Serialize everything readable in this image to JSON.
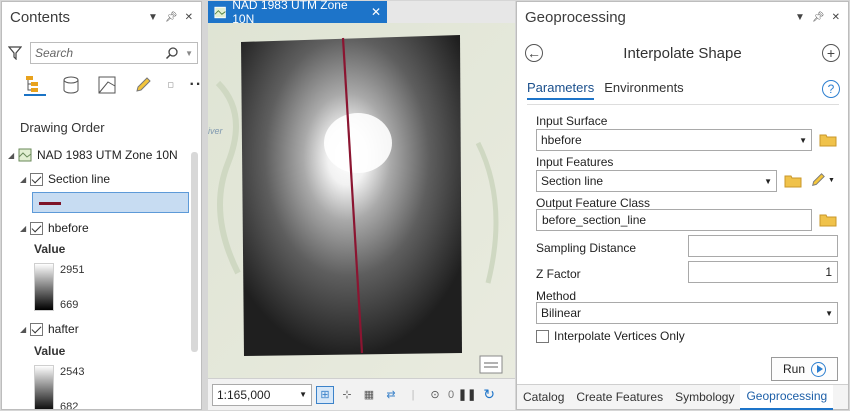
{
  "contents": {
    "title": "Contents",
    "search_placeholder": "Search",
    "drawing_order_label": "Drawing Order",
    "map_name": "NAD 1983 UTM Zone 10N",
    "layers": [
      {
        "name": "Section line",
        "checked": true
      },
      {
        "name": "hbefore",
        "checked": true,
        "value_label": "Value",
        "max": "2951",
        "min": "669"
      },
      {
        "name": "hafter",
        "checked": true,
        "value_label": "Value",
        "max": "2543",
        "min": "682"
      }
    ]
  },
  "map": {
    "tab_title": "NAD 1983 UTM Zone 10N",
    "scale": "1:165,000",
    "selected_count": "0",
    "basemap_label": "iver",
    "section_line_color": "#8b1531"
  },
  "geoprocessing": {
    "title": "Geoprocessing",
    "tool_title": "Interpolate Shape",
    "tabs": {
      "parameters": "Parameters",
      "environments": "Environments"
    },
    "fields": {
      "input_surface": {
        "label": "Input Surface",
        "value": "hbefore"
      },
      "input_features": {
        "label": "Input Features",
        "value": "Section line"
      },
      "output_feature_class": {
        "label": "Output Feature Class",
        "value": "before_section_line"
      },
      "sampling_distance": {
        "label": "Sampling Distance",
        "value": ""
      },
      "z_factor": {
        "label": "Z Factor",
        "value": "1"
      },
      "method": {
        "label": "Method",
        "value": "Bilinear"
      },
      "interpolate_vertices_only": {
        "label": "Interpolate Vertices Only",
        "checked": false
      }
    },
    "run_label": "Run",
    "bottom_tabs": [
      "Catalog",
      "Create Features",
      "Symbology",
      "Geoprocessing"
    ]
  },
  "colors": {
    "accent": "#1d74c9",
    "section_line": "#7e1428"
  }
}
